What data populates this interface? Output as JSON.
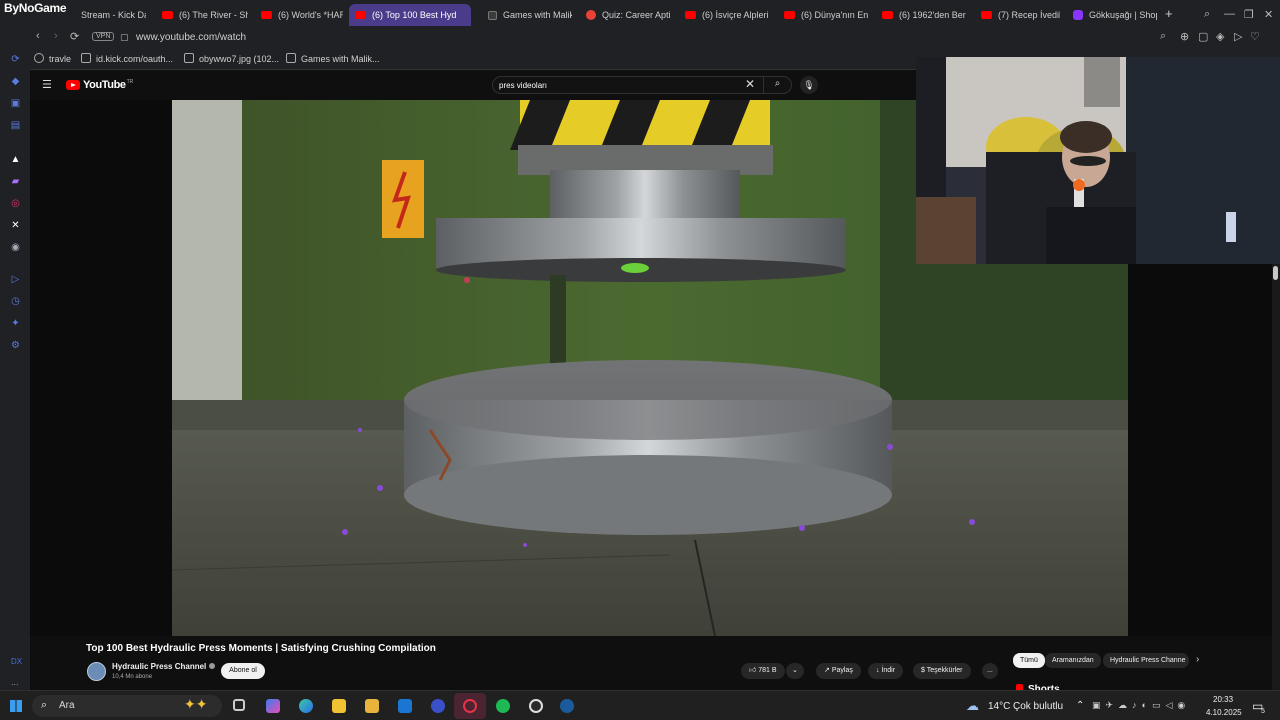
{
  "overlay_brand": "ByNoGame",
  "tabs": [
    {
      "label": "Stream - Kick Da",
      "icon": "kick-icon",
      "active": false
    },
    {
      "label": "(6) The River - Sh",
      "icon": "youtube-icon",
      "active": false
    },
    {
      "label": "(6) World's *HAR",
      "icon": "youtube-icon",
      "active": false
    },
    {
      "label": "(6) Top 100 Best Hyd",
      "icon": "youtube-icon",
      "active": true
    },
    {
      "label": "Games with Malik",
      "icon": "page-icon",
      "active": false
    },
    {
      "label": "Quiz: Career Apti",
      "icon": "quiz-icon",
      "active": false
    },
    {
      "label": "(6) İsviçre Alpleri",
      "icon": "youtube-icon",
      "active": false
    },
    {
      "label": "(6) Dünya'nın En",
      "icon": "youtube-icon",
      "active": false
    },
    {
      "label": "(6) 1962'den Ber",
      "icon": "youtube-icon",
      "active": false
    },
    {
      "label": "(7) Recep İvedik",
      "icon": "youtube-icon",
      "active": false
    },
    {
      "label": "Gökkuşağı | Shop",
      "icon": "s-icon",
      "active": false
    }
  ],
  "address": {
    "vpn": "VPN",
    "url": "www.youtube.com/watch"
  },
  "bookmarks": [
    "travle",
    "id.kick.com/oauth...",
    "obywwo7.jpg (102...",
    "Games with Malik..."
  ],
  "youtube": {
    "logo": "YouTube",
    "region": "TR",
    "search_value": "pres videoları",
    "video_title": "Top 100 Best Hydraulic Press Moments | Satisfying Crushing Compilation",
    "channel_name": "Hydraulic Press Channel",
    "subscribers": "10,4 Mn abone",
    "subscribe_label": "Abone ol",
    "likes": "781 B",
    "share_label": "Paylaş",
    "download_label": "İndir",
    "thanks_label": "Teşekkürler",
    "more_label": "...",
    "chips": [
      "Tümü",
      "Aramanızdan",
      "Hydraulic Press Channe"
    ],
    "shorts_label": "Shorts"
  },
  "sidebar": {
    "bottom_label": "DX",
    "more": "..."
  },
  "taskbar": {
    "search_placeholder": "Ara",
    "weather": "14°C",
    "weather_desc": "Çok bulutlu",
    "time": "20:33",
    "date": "4.10.2025",
    "notif_count": "5"
  },
  "colors": {
    "accent_tab": "#4a3c8a",
    "youtube_red": "#ff0000",
    "background": "#0f0f0f"
  }
}
